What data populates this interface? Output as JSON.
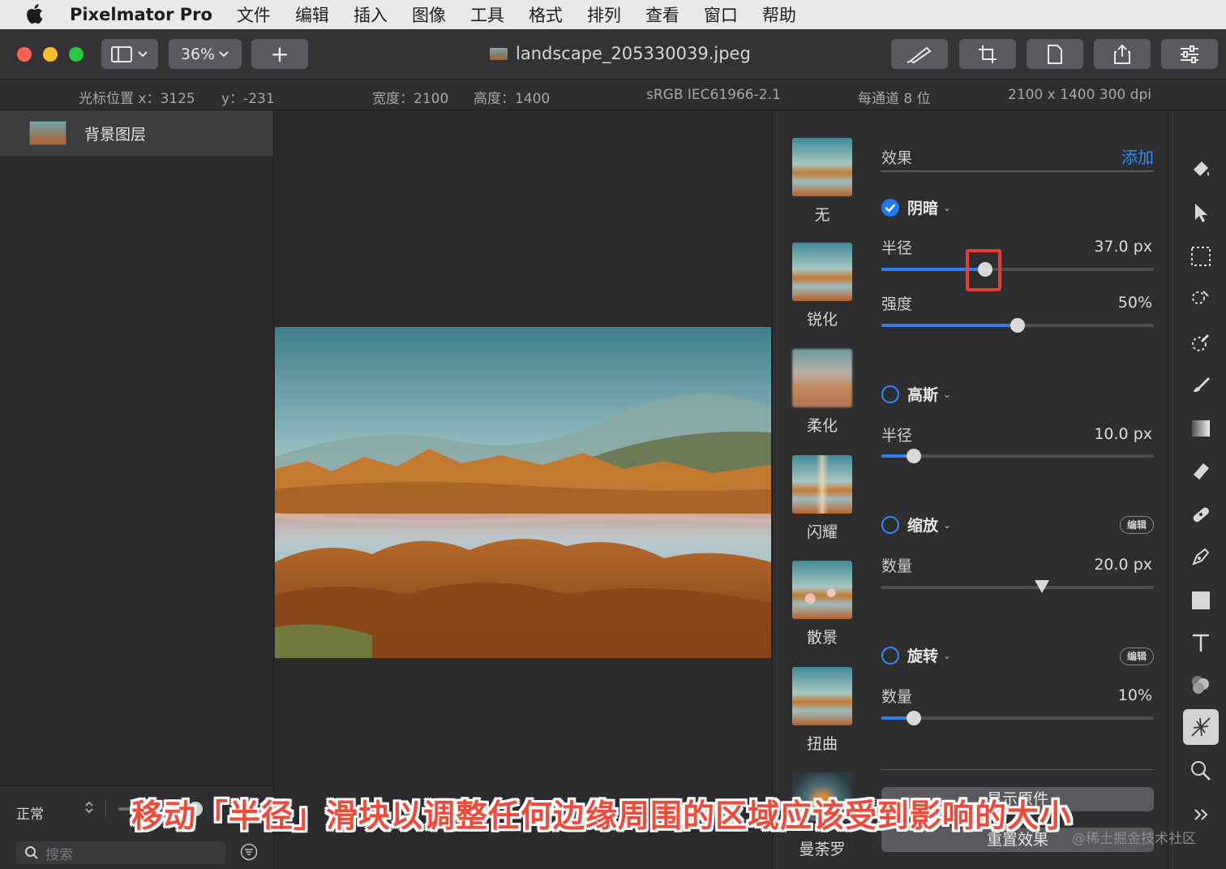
{
  "menubar": {
    "app_name": "Pixelmator Pro",
    "items": [
      "文件",
      "编辑",
      "插入",
      "图像",
      "工具",
      "格式",
      "排列",
      "查看",
      "窗口",
      "帮助"
    ]
  },
  "toolbar": {
    "zoom": "36%",
    "add_label": "+",
    "doc_title": "landscape_205330039.jpeg"
  },
  "infobar": {
    "cursor_x": "光标位置 x：3125",
    "cursor_y": "y：-231",
    "width": "宽度：2100",
    "height": "高度：1400",
    "profile": "sRGB IEC61966-2.1",
    "bits": "每通道 8 位",
    "size": "2100 x 1400 300 dpi"
  },
  "layers": {
    "items": [
      {
        "name": "背景图层"
      }
    ],
    "blend_mode": "正常",
    "search_placeholder": "搜索"
  },
  "effects": {
    "title": "效果",
    "add_label": "添加",
    "presets": [
      "无",
      "锐化",
      "柔化",
      "闪耀",
      "散景",
      "扭曲",
      "曼荼罗"
    ],
    "groups": [
      {
        "name": "阴暗",
        "enabled": true,
        "param_label": "半径",
        "param_value": "37.0 px",
        "slider_fraction": 0.38
      },
      {
        "name": "强度",
        "param_value": "50%",
        "slider_fraction": 0.5
      },
      {
        "name": "高斯",
        "enabled": false,
        "param_label": "半径",
        "param_value": "10.0 px",
        "slider_fraction": 0.12
      },
      {
        "name": "缩放",
        "enabled": false,
        "edit_label": "编辑",
        "param_label": "数量",
        "param_value": "20.0 px",
        "slider_fraction": 0.59
      },
      {
        "name": "旋转",
        "enabled": false,
        "edit_label": "编辑",
        "param_label": "数量",
        "param_value": "10%",
        "slider_fraction": 0.12
      }
    ],
    "show_original": "显示原件",
    "reset": "重置效果"
  },
  "colors": {
    "accent": "#2f8cff",
    "highlight": "#ec3b2f"
  },
  "caption": "移动「半径」滑块以调整任何边缘周围的区域应该受到影响的大小",
  "watermark": "@稀土掘金技术社区"
}
